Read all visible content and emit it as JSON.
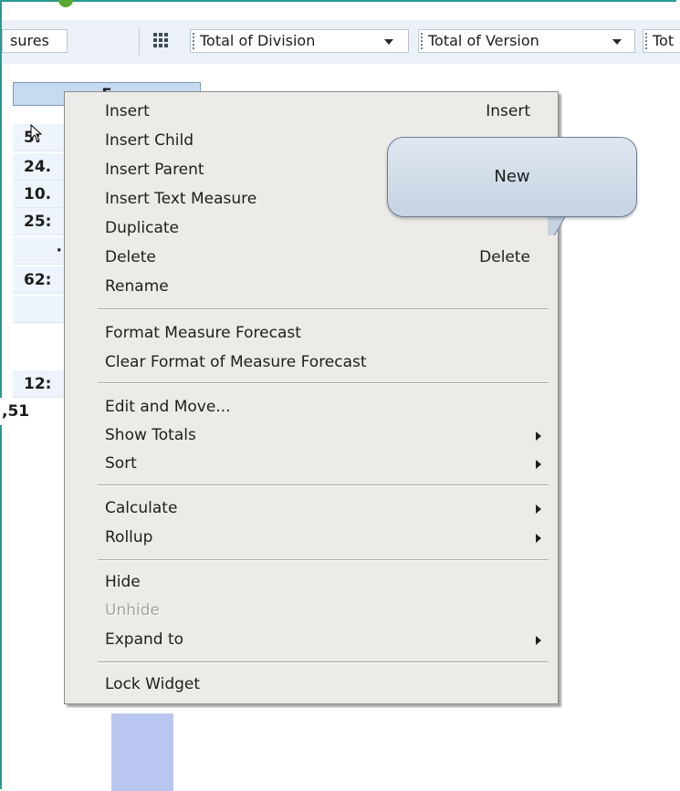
{
  "toolbar": {
    "measures_label": "sures",
    "dim_division": "Total of Division",
    "dim_version": "Total of Version",
    "dim_other": "Tot"
  },
  "grid": {
    "column_header": "F",
    "cells": [
      "5:",
      "24.",
      "10.",
      "25:",
      "·",
      "62:",
      "",
      "12:"
    ],
    "grand_total": ",51"
  },
  "context_menu": {
    "items": [
      {
        "label": "Insert",
        "shortcut": "Insert"
      },
      {
        "label": "Insert Child"
      },
      {
        "label": "Insert Parent"
      },
      {
        "label": "Insert Text Measure"
      },
      {
        "label": "Duplicate"
      },
      {
        "label": "Delete",
        "shortcut": "Delete"
      },
      {
        "label": "Rename"
      },
      {
        "label": "Format Measure Forecast"
      },
      {
        "label": "Clear Format of Measure Forecast"
      },
      {
        "label": "Edit and Move..."
      },
      {
        "label": "Show Totals",
        "submenu": true
      },
      {
        "label": "Sort",
        "submenu": true
      },
      {
        "label": "Calculate",
        "submenu": true
      },
      {
        "label": "Rollup",
        "submenu": true
      },
      {
        "label": "Hide"
      },
      {
        "label": "Unhide",
        "disabled": true
      },
      {
        "label": "Expand to",
        "submenu": true
      },
      {
        "label": "Lock Widget"
      }
    ]
  },
  "callout": {
    "text": "New"
  },
  "colors": {
    "frame": "#2a9a92",
    "menu_bg": "#ecebe7",
    "column_header_bg": "#c6daf1",
    "callout_bg": "#c6d3e2"
  }
}
